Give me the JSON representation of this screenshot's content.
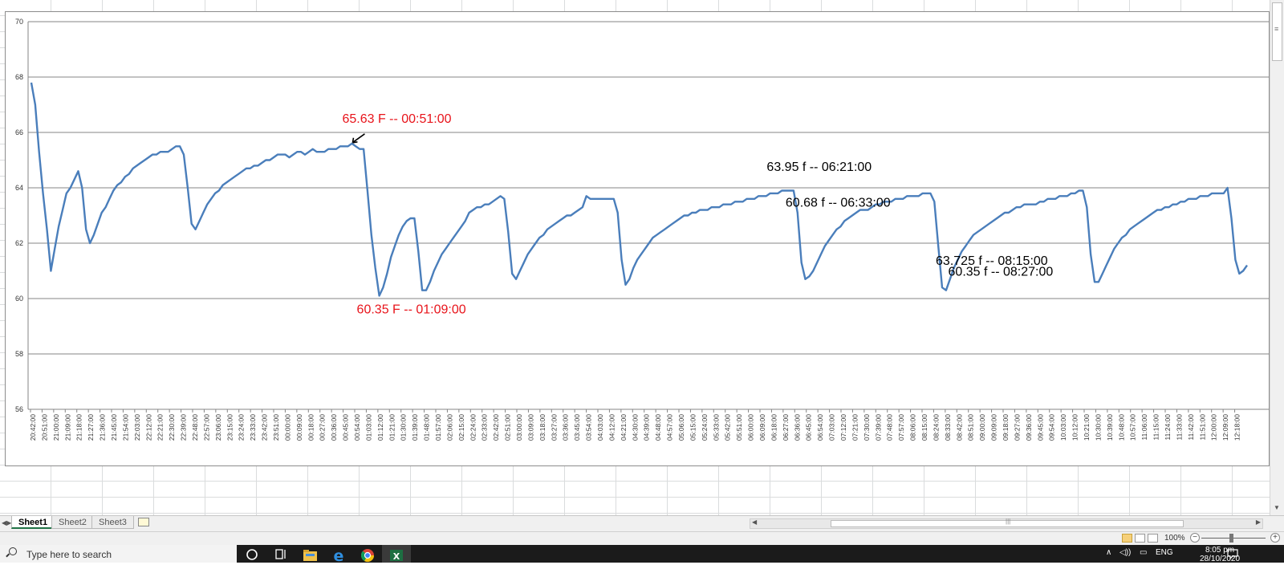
{
  "chart_data": {
    "type": "line",
    "title": "",
    "xlabel": "",
    "ylabel": "",
    "ylim": [
      56,
      70
    ],
    "yticks": [
      56,
      58,
      60,
      62,
      64,
      66,
      68,
      70
    ],
    "grid": "horizontal",
    "series": [
      {
        "color": "#4a7ebb",
        "values": [
          67.8,
          67.0,
          65.3,
          63.8,
          62.5,
          61.0,
          61.8,
          62.6,
          63.2,
          63.8,
          64.0,
          64.3,
          64.6,
          64.0,
          62.5,
          62.0,
          62.3,
          62.7,
          63.1,
          63.3,
          63.6,
          63.9,
          64.1,
          64.2,
          64.4,
          64.5,
          64.7,
          64.8,
          64.9,
          65.0,
          65.1,
          65.2,
          65.2,
          65.3,
          65.3,
          65.3,
          65.4,
          65.5,
          65.5,
          65.2,
          64.0,
          62.7,
          62.5,
          62.8,
          63.1,
          63.4,
          63.6,
          63.8,
          63.9,
          64.1,
          64.2,
          64.3,
          64.4,
          64.5,
          64.6,
          64.7,
          64.7,
          64.8,
          64.8,
          64.9,
          65.0,
          65.0,
          65.1,
          65.2,
          65.2,
          65.2,
          65.1,
          65.2,
          65.3,
          65.3,
          65.2,
          65.3,
          65.4,
          65.3,
          65.3,
          65.3,
          65.4,
          65.4,
          65.4,
          65.5,
          65.5,
          65.5,
          65.6,
          65.5,
          65.4,
          65.4,
          63.9,
          62.3,
          61.1,
          60.1,
          60.4,
          60.9,
          61.5,
          61.9,
          62.3,
          62.6,
          62.8,
          62.9,
          62.9,
          61.7,
          60.3,
          60.3,
          60.6,
          61.0,
          61.3,
          61.6,
          61.8,
          62.0,
          62.2,
          62.4,
          62.6,
          62.8,
          63.1,
          63.2,
          63.3,
          63.3,
          63.4,
          63.4,
          63.5,
          63.6,
          63.7,
          63.6,
          62.4,
          60.9,
          60.7,
          61.0,
          61.3,
          61.6,
          61.8,
          62.0,
          62.2,
          62.3,
          62.5,
          62.6,
          62.7,
          62.8,
          62.9,
          63.0,
          63.0,
          63.1,
          63.2,
          63.3,
          63.7,
          63.6,
          63.6,
          63.6,
          63.6,
          63.6,
          63.6,
          63.6,
          63.1,
          61.4,
          60.5,
          60.7,
          61.1,
          61.4,
          61.6,
          61.8,
          62.0,
          62.2,
          62.3,
          62.4,
          62.5,
          62.6,
          62.7,
          62.8,
          62.9,
          63.0,
          63.0,
          63.1,
          63.1,
          63.2,
          63.2,
          63.2,
          63.3,
          63.3,
          63.3,
          63.4,
          63.4,
          63.4,
          63.5,
          63.5,
          63.5,
          63.6,
          63.6,
          63.6,
          63.7,
          63.7,
          63.7,
          63.8,
          63.8,
          63.8,
          63.9,
          63.9,
          63.9,
          63.9,
          63.1,
          61.3,
          60.7,
          60.8,
          61.0,
          61.3,
          61.6,
          61.9,
          62.1,
          62.3,
          62.5,
          62.6,
          62.8,
          62.9,
          63.0,
          63.1,
          63.2,
          63.2,
          63.2,
          63.3,
          63.4,
          63.4,
          63.5,
          63.5,
          63.5,
          63.6,
          63.6,
          63.6,
          63.7,
          63.7,
          63.7,
          63.7,
          63.8,
          63.8,
          63.8,
          63.5,
          61.9,
          60.4,
          60.3,
          60.7,
          61.1,
          61.4,
          61.7,
          61.9,
          62.1,
          62.3,
          62.4,
          62.5,
          62.6,
          62.7,
          62.8,
          62.9,
          63.0,
          63.1,
          63.1,
          63.2,
          63.3,
          63.3,
          63.4,
          63.4,
          63.4,
          63.4,
          63.5,
          63.5,
          63.6,
          63.6,
          63.6,
          63.7,
          63.7,
          63.7,
          63.8,
          63.8,
          63.9,
          63.9,
          63.3,
          61.6,
          60.6,
          60.6,
          60.9,
          61.2,
          61.5,
          61.8,
          62.0,
          62.2,
          62.3,
          62.5,
          62.6,
          62.7,
          62.8,
          62.9,
          63.0,
          63.1,
          63.2,
          63.2,
          63.3,
          63.3,
          63.4,
          63.4,
          63.5,
          63.5,
          63.6,
          63.6,
          63.6,
          63.7,
          63.7,
          63.7,
          63.8,
          63.8,
          63.8,
          63.8,
          64.0,
          62.9,
          61.4,
          60.9,
          61.0,
          61.2
        ]
      }
    ],
    "x_tick_labels": [
      "20:42:00",
      "20:51:00",
      "21:00:00",
      "21:09:00",
      "21:18:00",
      "21:27:00",
      "21:36:00",
      "21:45:00",
      "21:54:00",
      "22:03:00",
      "22:12:00",
      "22:21:00",
      "22:30:00",
      "22:39:00",
      "22:48:00",
      "22:57:00",
      "23:06:00",
      "23:15:00",
      "23:24:00",
      "23:33:00",
      "23:42:00",
      "23:51:00",
      "00:00:00",
      "00:09:00",
      "00:18:00",
      "00:27:00",
      "00:36:00",
      "00:45:00",
      "00:54:00",
      "01:03:00",
      "01:12:00",
      "01:21:00",
      "01:30:00",
      "01:39:00",
      "01:48:00",
      "01:57:00",
      "02:06:00",
      "02:15:00",
      "02:24:00",
      "02:33:00",
      "02:42:00",
      "02:51:00",
      "03:00:00",
      "03:09:00",
      "03:18:00",
      "03:27:00",
      "03:36:00",
      "03:45:00",
      "03:54:00",
      "04:03:00",
      "04:12:00",
      "04:21:00",
      "04:30:00",
      "04:39:00",
      "04:48:00",
      "04:57:00",
      "05:06:00",
      "05:15:00",
      "05:24:00",
      "05:33:00",
      "05:42:00",
      "05:51:00",
      "06:00:00",
      "06:09:00",
      "06:18:00",
      "06:27:00",
      "06:36:00",
      "06:45:00",
      "06:54:00",
      "07:03:00",
      "07:12:00",
      "07:21:00",
      "07:30:00",
      "07:39:00",
      "07:48:00",
      "07:57:00",
      "08:06:00",
      "08:15:00",
      "08:24:00",
      "08:33:00",
      "08:42:00",
      "08:51:00",
      "09:00:00",
      "09:09:00",
      "09:18:00",
      "09:27:00",
      "09:36:00",
      "09:45:00",
      "09:54:00",
      "10:03:00",
      "10:12:00",
      "10:21:00",
      "10:30:00",
      "10:39:00",
      "10:48:00",
      "10:57:00",
      "11:06:00",
      "11:15:00",
      "11:24:00",
      "11:33:00",
      "11:42:00",
      "11:51:00",
      "12:00:00",
      "12:09:00",
      "12:18:00"
    ],
    "annotations": [
      {
        "text": "65.63 F -- 00:51:00",
        "color": "#e8141b",
        "index": 82,
        "dy": -26,
        "dx": -12,
        "arrow": true
      },
      {
        "text": "60.35 F -- 01:09:00",
        "color": "#e8141b",
        "index": 89,
        "dy": 22,
        "dx": -28
      },
      {
        "text": "63.95 f -- 06:21:00",
        "color": "#000000",
        "index": 191,
        "dy": -28,
        "dx": -14
      },
      {
        "text": "60.68 f -- 06:33:00",
        "color": "#000000",
        "index": 195,
        "dy": 20,
        "dx": -10
      },
      {
        "text": "63.725 f -- 08:15:00",
        "color": "#000000",
        "index": 233,
        "dy": -28,
        "dx": -8
      },
      {
        "text": "60.35 f -- 08:27:00",
        "color": "#000000",
        "index": 237,
        "dy": 20,
        "dx": -12
      }
    ]
  },
  "sheet_tabs": [
    {
      "label": "Sheet1",
      "active": true
    },
    {
      "label": "Sheet2",
      "active": false
    },
    {
      "label": "Sheet3",
      "active": false
    }
  ],
  "status": {
    "zoom": "100%",
    "zoom_minus": "−",
    "zoom_plus": "+"
  },
  "taskbar": {
    "search_placeholder": "Type here to search",
    "language": "ENG",
    "time": "8:05 pm",
    "date": "28/10/2020",
    "icons": [
      "cortana-icon",
      "task-view-icon",
      "file-explorer-icon",
      "edge-icon",
      "chrome-icon",
      "excel-icon"
    ]
  }
}
